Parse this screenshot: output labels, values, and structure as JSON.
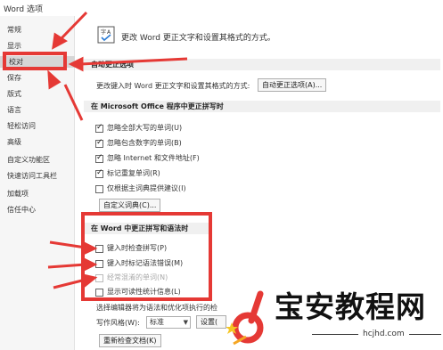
{
  "window": {
    "title": "Word 选项"
  },
  "sidebar": {
    "items": [
      {
        "label": "常规"
      },
      {
        "label": "显示"
      },
      {
        "label": "校对"
      },
      {
        "label": "保存"
      },
      {
        "label": "版式"
      },
      {
        "label": "语言"
      },
      {
        "label": "轻松访问"
      },
      {
        "label": "高级"
      },
      {
        "label": "自定义功能区"
      },
      {
        "label": "快速访问工具栏"
      },
      {
        "label": "加载项"
      },
      {
        "label": "信任中心"
      }
    ],
    "selected": "校对"
  },
  "header": {
    "text": "更改 Word 更正文字和设置其格式的方式。",
    "icon": "proofing-abc-check-icon"
  },
  "autocorrect": {
    "title": "自动更正选项",
    "description": "更改键入时 Word 更正文字和设置其格式的方式:",
    "button_label": "自动更正选项(A)..."
  },
  "office_section": {
    "title": "在 Microsoft Office 程序中更正拼写时",
    "options": [
      {
        "label": "忽略全部大写的单词(U)",
        "checked": true
      },
      {
        "label": "忽略包含数字的单词(B)",
        "checked": true
      },
      {
        "label": "忽略 Internet 和文件地址(F)",
        "checked": true
      },
      {
        "label": "标记重复单词(R)",
        "checked": true
      },
      {
        "label": "仅根据主词典提供建议(I)",
        "checked": false
      }
    ],
    "custom_dict_button": "自定义词典(C)..."
  },
  "word_section": {
    "title": "在 Word 中更正拼写和语法时",
    "options": [
      {
        "label": "键入时检查拼写(P)",
        "checked": false,
        "disabled": false
      },
      {
        "label": "键入时标记语法错误(M)",
        "checked": false,
        "disabled": false
      },
      {
        "label": "经常混淆的单词(N)",
        "checked": false,
        "disabled": true
      },
      {
        "label": "显示可读性统计信息(L)",
        "checked": false,
        "disabled": false
      }
    ],
    "editor_note": "选择编辑器将为语法和优化项执行的检",
    "writing_style_label": "写作风格(W):",
    "writing_style_value": "标准",
    "settings_button": "设置(",
    "recheck_button": "重新检查文档(K)"
  },
  "watermark": {
    "title": "宝安教程网",
    "url": "hcjhd.com"
  },
  "annotation_color": "#e53935"
}
